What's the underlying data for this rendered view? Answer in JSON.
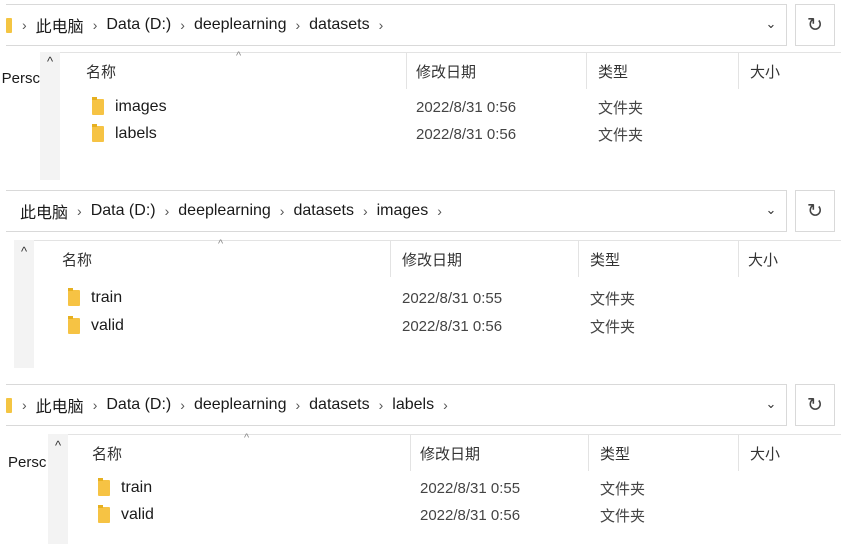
{
  "panels": [
    {
      "breadcrumb": [
        "此电脑",
        "Data (D:)",
        "deeplearning",
        "datasets"
      ],
      "nav_label": "Persc",
      "columns": {
        "name": "名称",
        "date": "修改日期",
        "type": "类型",
        "size": "大小"
      },
      "rows": [
        {
          "name": "images",
          "date": "2022/8/31 0:56",
          "type": "文件夹"
        },
        {
          "name": "labels",
          "date": "2022/8/31 0:56",
          "type": "文件夹"
        }
      ]
    },
    {
      "breadcrumb": [
        "此电脑",
        "Data (D:)",
        "deeplearning",
        "datasets",
        "images"
      ],
      "nav_label": "",
      "columns": {
        "name": "名称",
        "date": "修改日期",
        "type": "类型",
        "size": "大小"
      },
      "rows": [
        {
          "name": "train",
          "date": "2022/8/31 0:55",
          "type": "文件夹"
        },
        {
          "name": "valid",
          "date": "2022/8/31 0:56",
          "type": "文件夹"
        }
      ]
    },
    {
      "breadcrumb": [
        "此电脑",
        "Data (D:)",
        "deeplearning",
        "datasets",
        "labels"
      ],
      "nav_label": "Persc",
      "columns": {
        "name": "名称",
        "date": "修改日期",
        "type": "类型",
        "size": "大小"
      },
      "rows": [
        {
          "name": "train",
          "date": "2022/8/31 0:55",
          "type": "文件夹"
        },
        {
          "name": "valid",
          "date": "2022/8/31 0:56",
          "type": "文件夹"
        }
      ]
    }
  ],
  "icons": {
    "breadcrumb_separator": "chevron-right-icon",
    "dropdown": "chevron-down-icon",
    "refresh": "refresh-icon",
    "sort": "sort-ascending-icon",
    "nav_up": "scroll-up-icon",
    "folder": "folder-icon"
  },
  "colors": {
    "folder": "#f6c344",
    "border": "#d9d9d9",
    "nav_strip": "#f3f3f3"
  }
}
